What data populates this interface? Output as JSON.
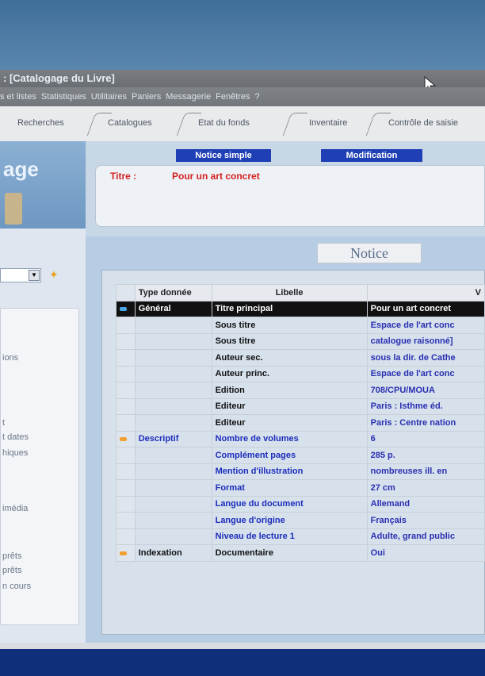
{
  "window": {
    "title": ": [Catalogage du Livre]"
  },
  "menu": [
    "s et listes",
    "Statistiques",
    "Utilitaires",
    "Paniers",
    "Messagerie",
    "Fenêtres",
    "?"
  ],
  "toolbar": [
    "Recherches",
    "Catalogues",
    "Etat du fonds",
    "Inventaire",
    "Contrôle de saisie"
  ],
  "app": {
    "title": "age"
  },
  "left_list": [
    "ions",
    "t",
    "t dates",
    "hiques",
    "imédia",
    "prêts",
    "prêts",
    "n cours"
  ],
  "tabs": {
    "notice_simple": "Notice simple",
    "modification": "Modification"
  },
  "titre": {
    "label": "Titre :",
    "value": "Pour un art concret"
  },
  "notice": {
    "label": "Notice"
  },
  "table": {
    "headers": {
      "type": "Type donnée",
      "libelle": "Libelle",
      "valeur": "V"
    },
    "rows": [
      {
        "type": "Général",
        "libelle": "Titre principal",
        "valeur": "Pour un art concret",
        "marker": "blue",
        "selected": true,
        "blue": false
      },
      {
        "type": "",
        "libelle": "Sous titre",
        "valeur": "Espace de l'art conc",
        "marker": "",
        "selected": false,
        "blue": false
      },
      {
        "type": "",
        "libelle": "Sous titre",
        "valeur": "catalogue raisonné]",
        "marker": "",
        "selected": false,
        "blue": false
      },
      {
        "type": "",
        "libelle": "Auteur sec.",
        "valeur": "sous la dir. de Cathe",
        "marker": "",
        "selected": false,
        "blue": false
      },
      {
        "type": "",
        "libelle": "Auteur princ.",
        "valeur": "Espace de l'art conc",
        "marker": "",
        "selected": false,
        "blue": false
      },
      {
        "type": "",
        "libelle": "Edition",
        "valeur": "708/CPU/MOUA",
        "marker": "",
        "selected": false,
        "blue": false
      },
      {
        "type": "",
        "libelle": "Editeur",
        "valeur": "Paris : Isthme éd.",
        "marker": "",
        "selected": false,
        "blue": false
      },
      {
        "type": "",
        "libelle": "Editeur",
        "valeur": "Paris : Centre nation",
        "marker": "",
        "selected": false,
        "blue": false
      },
      {
        "type": "Descriptif",
        "libelle": "Nombre de volumes",
        "valeur": "6",
        "marker": "orange",
        "selected": false,
        "blue": true
      },
      {
        "type": "",
        "libelle": "Complément pages",
        "valeur": "285 p.",
        "marker": "",
        "selected": false,
        "blue": true
      },
      {
        "type": "",
        "libelle": "Mention d'illustration",
        "valeur": "nombreuses ill. en",
        "marker": "",
        "selected": false,
        "blue": true
      },
      {
        "type": "",
        "libelle": "Format",
        "valeur": "27 cm",
        "marker": "",
        "selected": false,
        "blue": true
      },
      {
        "type": "",
        "libelle": "Langue du document",
        "valeur": "Allemand",
        "marker": "",
        "selected": false,
        "blue": true
      },
      {
        "type": "",
        "libelle": "Langue d'origine",
        "valeur": "Français",
        "marker": "",
        "selected": false,
        "blue": true
      },
      {
        "type": "",
        "libelle": "Niveau de lecture 1",
        "valeur": "Adulte, grand public",
        "marker": "",
        "selected": false,
        "blue": true
      },
      {
        "type": "Indexation",
        "libelle": "Documentaire",
        "valeur": "Oui",
        "marker": "orange",
        "selected": false,
        "blue": false
      }
    ]
  },
  "colors": {
    "accent": "#1f3fb5",
    "title_red": "#d42020",
    "selected_row": "#111111"
  }
}
